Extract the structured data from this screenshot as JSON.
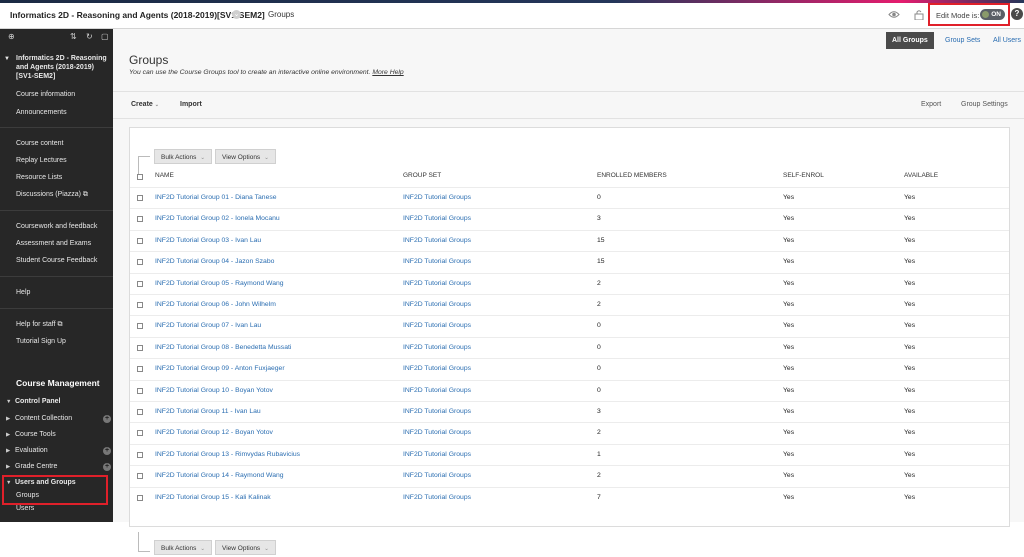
{
  "topbar": {
    "course_title": "Informatics 2D - Reasoning and Agents (2018-2019)[SV1-SEM2]",
    "breadcrumb": "Groups",
    "edit_mode_label": "Edit Mode is:",
    "edit_mode_value": "ON",
    "help_label": "?",
    "accent_color": "#e51c6e"
  },
  "sidebar": {
    "course_name": "Informatics 2D - Reasoning and Agents (2018-2019)[SV1-SEM2]",
    "items": [
      "Course information",
      "Announcements",
      "Course content",
      "Replay Lectures",
      "Resource Lists",
      "Discussions (Piazza)",
      "Coursework and feedback",
      "Assessment and Exams",
      "Student Course Feedback",
      "Help",
      "Help for staff",
      "Tutorial Sign Up"
    ],
    "management_heading": "Course Management",
    "control_panel": "Control Panel",
    "tree": [
      "Content Collection",
      "Course Tools",
      "Evaluation",
      "Grade Centre"
    ],
    "users_and_groups": "Users and Groups",
    "sub_items": [
      "Groups",
      "Users"
    ]
  },
  "tabs": [
    "All Groups",
    "Group Sets",
    "All Users"
  ],
  "page": {
    "title": "Groups",
    "description": "You can use the Course Groups tool to create an interactive online environment.",
    "more_help": "More Help"
  },
  "actions": {
    "create": "Create",
    "import": "Import",
    "export": "Export",
    "group_settings": "Group Settings"
  },
  "table": {
    "bulk_actions": "Bulk Actions",
    "view_options": "View Options",
    "columns": [
      "NAME",
      "GROUP SET",
      "ENROLLED MEMBERS",
      "SELF-ENROL",
      "AVAILABLE"
    ],
    "rows": [
      {
        "name": "INF2D Tutorial Group 01 - Diana Tanese",
        "set": "INF2D Tutorial Groups",
        "members": "0",
        "self": "Yes",
        "avail": "Yes"
      },
      {
        "name": "INF2D Tutorial Group 02 - Ionela Mocanu",
        "set": "INF2D Tutorial Groups",
        "members": "3",
        "self": "Yes",
        "avail": "Yes"
      },
      {
        "name": "INF2D Tutorial Group 03 - Ivan Lau",
        "set": "INF2D Tutorial Groups",
        "members": "15",
        "self": "Yes",
        "avail": "Yes"
      },
      {
        "name": "INF2D Tutorial Group 04 - Jazon Szabo",
        "set": "INF2D Tutorial Groups",
        "members": "15",
        "self": "Yes",
        "avail": "Yes"
      },
      {
        "name": "INF2D Tutorial Group 05 - Raymond Wang",
        "set": "INF2D Tutorial Groups",
        "members": "2",
        "self": "Yes",
        "avail": "Yes"
      },
      {
        "name": "INF2D Tutorial Group 06 - John Wilhelm",
        "set": "INF2D Tutorial Groups",
        "members": "2",
        "self": "Yes",
        "avail": "Yes"
      },
      {
        "name": "INF2D Tutorial Group 07 - Ivan Lau",
        "set": "INF2D Tutorial Groups",
        "members": "0",
        "self": "Yes",
        "avail": "Yes"
      },
      {
        "name": "INF2D Tutorial Group 08 - Benedetta Mussati",
        "set": "INF2D Tutorial Groups",
        "members": "0",
        "self": "Yes",
        "avail": "Yes"
      },
      {
        "name": "INF2D Tutorial Group 09 - Anton Fuxjaeger",
        "set": "INF2D Tutorial Groups",
        "members": "0",
        "self": "Yes",
        "avail": "Yes"
      },
      {
        "name": "INF2D Tutorial Group 10 - Boyan Yotov",
        "set": "INF2D Tutorial Groups",
        "members": "0",
        "self": "Yes",
        "avail": "Yes"
      },
      {
        "name": "INF2D Tutorial Group 11 - Ivan Lau",
        "set": "INF2D Tutorial Groups",
        "members": "3",
        "self": "Yes",
        "avail": "Yes"
      },
      {
        "name": "INF2D Tutorial Group 12 - Boyan Yotov",
        "set": "INF2D Tutorial Groups",
        "members": "2",
        "self": "Yes",
        "avail": "Yes"
      },
      {
        "name": "INF2D Tutorial Group 13 - Rimvydas Rubavicius",
        "set": "INF2D Tutorial Groups",
        "members": "1",
        "self": "Yes",
        "avail": "Yes"
      },
      {
        "name": "INF2D Tutorial Group 14 - Raymond Wang",
        "set": "INF2D Tutorial Groups",
        "members": "2",
        "self": "Yes",
        "avail": "Yes"
      },
      {
        "name": "INF2D Tutorial Group 15 - Kali Kalinak",
        "set": "INF2D Tutorial Groups",
        "members": "7",
        "self": "Yes",
        "avail": "Yes"
      }
    ]
  }
}
